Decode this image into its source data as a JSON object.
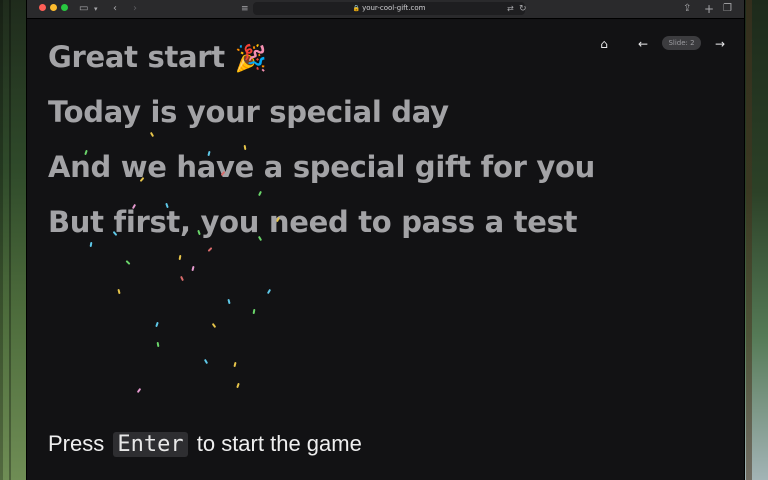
{
  "browser": {
    "url": "your-cool-gift.com",
    "icons": [
      "sidebar-icon",
      "chevron-down-icon",
      "back-icon",
      "forward-icon",
      "reader-icon",
      "lock-icon",
      "translate-icon",
      "reload-icon",
      "share-icon",
      "plus-icon",
      "tabs-icon"
    ]
  },
  "slide": {
    "lines": [
      "Great start",
      "Today is your special day",
      "And we have a special gift for you",
      "But first, you need to pass a test"
    ],
    "emoji": "🎉",
    "badge": "Slide: 2"
  },
  "footer": {
    "before": "Press",
    "key": "Enter",
    "after": "to start the game"
  }
}
